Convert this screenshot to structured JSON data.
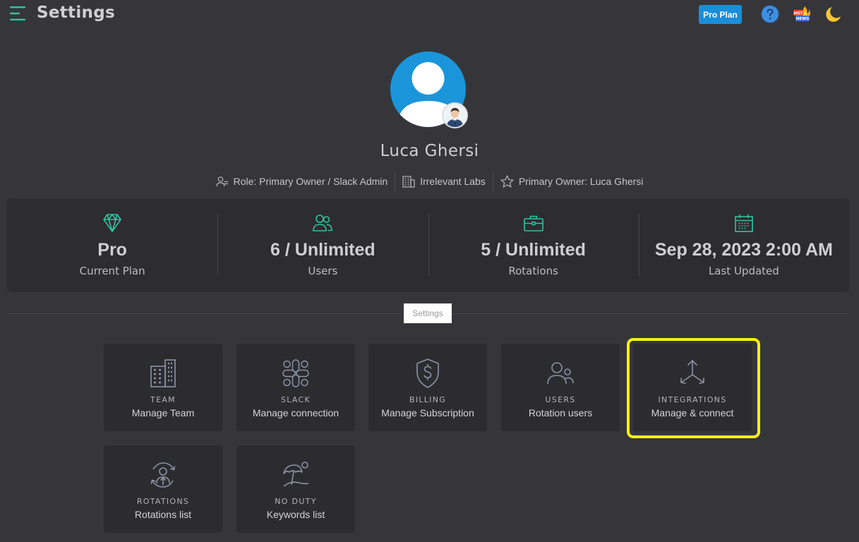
{
  "header": {
    "title": "Settings",
    "pro_plan_label": "Pro Plan",
    "icons": [
      "menu-icon",
      "help-icon",
      "hot-news-icon",
      "dark-mode-moon-icon"
    ]
  },
  "profile": {
    "name": "Luca Ghersi",
    "role": "Role: Primary Owner / Slack Admin",
    "workspace": "Irrelevant Labs",
    "primary_owner": "Primary Owner: Luca Ghersi"
  },
  "stats": [
    {
      "value": "Pro",
      "label": "Current Plan",
      "icon": "diamond-icon"
    },
    {
      "value": "6 / Unlimited",
      "label": "Users",
      "icon": "users-icon"
    },
    {
      "value": "5 / Unlimited",
      "label": "Rotations",
      "icon": "briefcase-icon"
    },
    {
      "value": "Sep 28, 2023 2:00 AM",
      "label": "Last Updated",
      "icon": "calendar-icon"
    }
  ],
  "section_label": "Settings",
  "cards": [
    {
      "title": "TEAM",
      "subtitle": "Manage Team",
      "icon": "building-icon"
    },
    {
      "title": "SLACK",
      "subtitle": "Manage connection",
      "icon": "slack-icon"
    },
    {
      "title": "BILLING",
      "subtitle": "Manage Subscription",
      "icon": "shield-dollar-icon"
    },
    {
      "title": "USERS",
      "subtitle": "Rotation users",
      "icon": "users-icon"
    },
    {
      "title": "INTEGRATIONS",
      "subtitle": "Manage & connect",
      "icon": "integrations-icon",
      "highlighted": true
    },
    {
      "title": "ROTATIONS",
      "subtitle": "Rotations list",
      "icon": "rotation-icon"
    },
    {
      "title": "NO DUTY",
      "subtitle": "Keywords list",
      "icon": "beach-umbrella-icon"
    }
  ],
  "colors": {
    "background": "#36363a",
    "panel": "#2d2d31",
    "accent_green": "#2ec4a0",
    "primary_blue": "#1a8ed8",
    "highlight_yellow": "#f5f505"
  }
}
